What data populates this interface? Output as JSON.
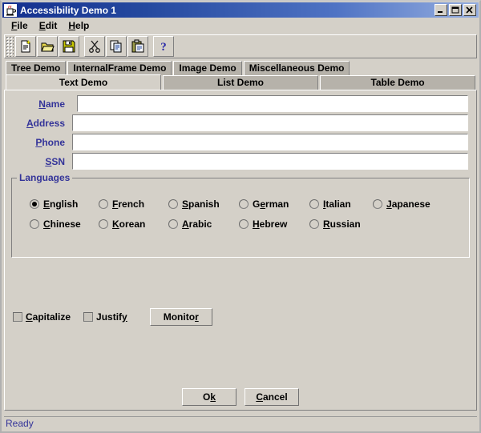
{
  "window": {
    "title": "Accessibility Demo 1",
    "icon": "java-coffee-cup-icon",
    "controls": {
      "minimize": "minimize-icon",
      "maximize": "maximize-icon",
      "close": "close-icon"
    },
    "colors": {
      "title_gradient_start": "#14308f",
      "title_gradient_end": "#95aee0",
      "face": "#d4d0c8",
      "label_blue": "#333399",
      "tab_unselected": "#b6b2aa"
    }
  },
  "menubar": {
    "items": [
      {
        "label": "File",
        "mnemonic": "F"
      },
      {
        "label": "Edit",
        "mnemonic": "E"
      },
      {
        "label": "Help",
        "mnemonic": "H"
      }
    ]
  },
  "toolbar": {
    "buttons": [
      {
        "name": "new-icon",
        "tooltip": "New"
      },
      {
        "name": "open-folder-icon",
        "tooltip": "Open"
      },
      {
        "name": "save-floppy-icon",
        "tooltip": "Save"
      },
      {
        "name": "cut-scissors-icon",
        "tooltip": "Cut"
      },
      {
        "name": "copy-icon",
        "tooltip": "Copy"
      },
      {
        "name": "paste-clipboard-icon",
        "tooltip": "Paste"
      },
      {
        "name": "help-question-icon",
        "tooltip": "Help"
      }
    ]
  },
  "tabs": {
    "row1": [
      {
        "label": "Tree Demo",
        "selected": false
      },
      {
        "label": "InternalFrame Demo",
        "selected": false
      },
      {
        "label": "Image Demo",
        "selected": false
      },
      {
        "label": "Miscellaneous Demo",
        "selected": false
      }
    ],
    "row2": [
      {
        "label": "Text Demo",
        "selected": true
      },
      {
        "label": "List Demo",
        "selected": false
      },
      {
        "label": "Table Demo",
        "selected": false
      }
    ]
  },
  "form": {
    "fields": [
      {
        "label": "Name",
        "mnemonic": "N",
        "value": "",
        "placeholder": ""
      },
      {
        "label": "Address",
        "mnemonic": "A",
        "value": "",
        "placeholder": ""
      },
      {
        "label": "Phone",
        "mnemonic": "P",
        "value": "",
        "placeholder": ""
      },
      {
        "label": "SSN",
        "mnemonic": "S",
        "value": "",
        "placeholder": ""
      }
    ]
  },
  "languages": {
    "title": "Languages",
    "selected": "English",
    "row1": [
      {
        "label": "English",
        "mnemonic": "E",
        "checked": true
      },
      {
        "label": "French",
        "mnemonic": "F",
        "checked": false
      },
      {
        "label": "Spanish",
        "mnemonic": "S",
        "checked": false
      },
      {
        "label": "German",
        "mnemonic": "e",
        "checked": false
      },
      {
        "label": "Italian",
        "mnemonic": "I",
        "checked": false
      },
      {
        "label": "Japanese",
        "mnemonic": "J",
        "checked": false
      }
    ],
    "row2": [
      {
        "label": "Chinese",
        "mnemonic": "C",
        "checked": false
      },
      {
        "label": "Korean",
        "mnemonic": "K",
        "checked": false
      },
      {
        "label": "Arabic",
        "mnemonic": "A",
        "checked": false
      },
      {
        "label": "Hebrew",
        "mnemonic": "H",
        "checked": false
      },
      {
        "label": "Russian",
        "mnemonic": "R",
        "checked": false
      }
    ]
  },
  "options": {
    "checkboxes": [
      {
        "label": "Capitalize",
        "mnemonic": "C",
        "checked": false
      },
      {
        "label": "Justify",
        "mnemonic": "y",
        "checked": false
      }
    ],
    "monitor_button": {
      "label": "Monitor",
      "mnemonic": "r"
    }
  },
  "footer": {
    "ok_button": {
      "label": "Ok",
      "mnemonic": "k"
    },
    "cancel_button": {
      "label": "Cancel",
      "mnemonic": "C"
    }
  },
  "statusbar": {
    "text": "Ready"
  }
}
